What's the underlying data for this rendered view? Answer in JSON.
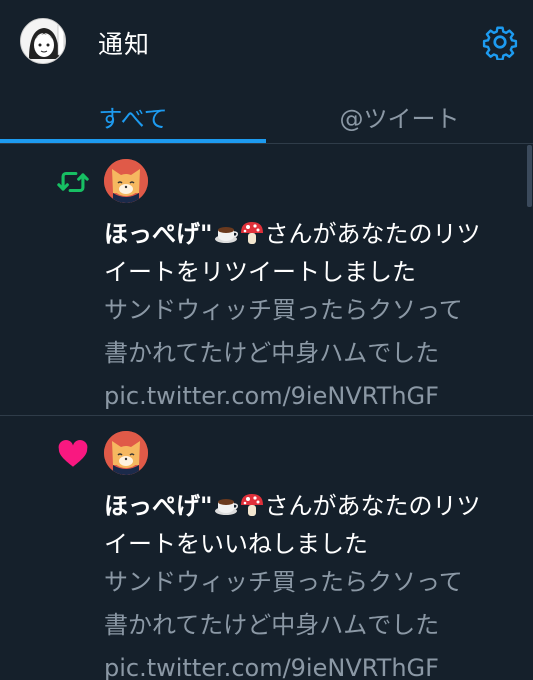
{
  "header": {
    "title": "通知",
    "settings_icon": "gear-icon"
  },
  "tabs": [
    {
      "label": "すべて",
      "active": true
    },
    {
      "label": "@ツイート",
      "active": false
    }
  ],
  "colors": {
    "background": "#15202b",
    "accent": "#1d9bf0",
    "retweet": "#17bf63",
    "like": "#f91880",
    "secondary_text": "#8b98a5"
  },
  "notifications": [
    {
      "type": "retweet",
      "icon": "retweet-icon",
      "user_name": "ほっぺげ\"",
      "emoji": [
        "coffee-icon",
        "mushroom-icon"
      ],
      "message_line1": "さんがあなたのリツ",
      "message_line2": "イートをリツイートしました",
      "tweet_lines": [
        "サンドウィッチ買ったらクソって",
        "書かれてたけど中身ハムでした",
        "pic.twitter.com/9ieNVRThGF"
      ]
    },
    {
      "type": "like",
      "icon": "heart-icon",
      "user_name": "ほっぺげ\"",
      "emoji": [
        "coffee-icon",
        "mushroom-icon"
      ],
      "message_line1": "さんがあなたのリツ",
      "message_line2": "イートをいいねしました",
      "tweet_lines": [
        "サンドウィッチ買ったらクソって",
        "書かれてたけど中身ハムでした",
        "pic.twitter.com/9ieNVRThGF"
      ]
    }
  ]
}
